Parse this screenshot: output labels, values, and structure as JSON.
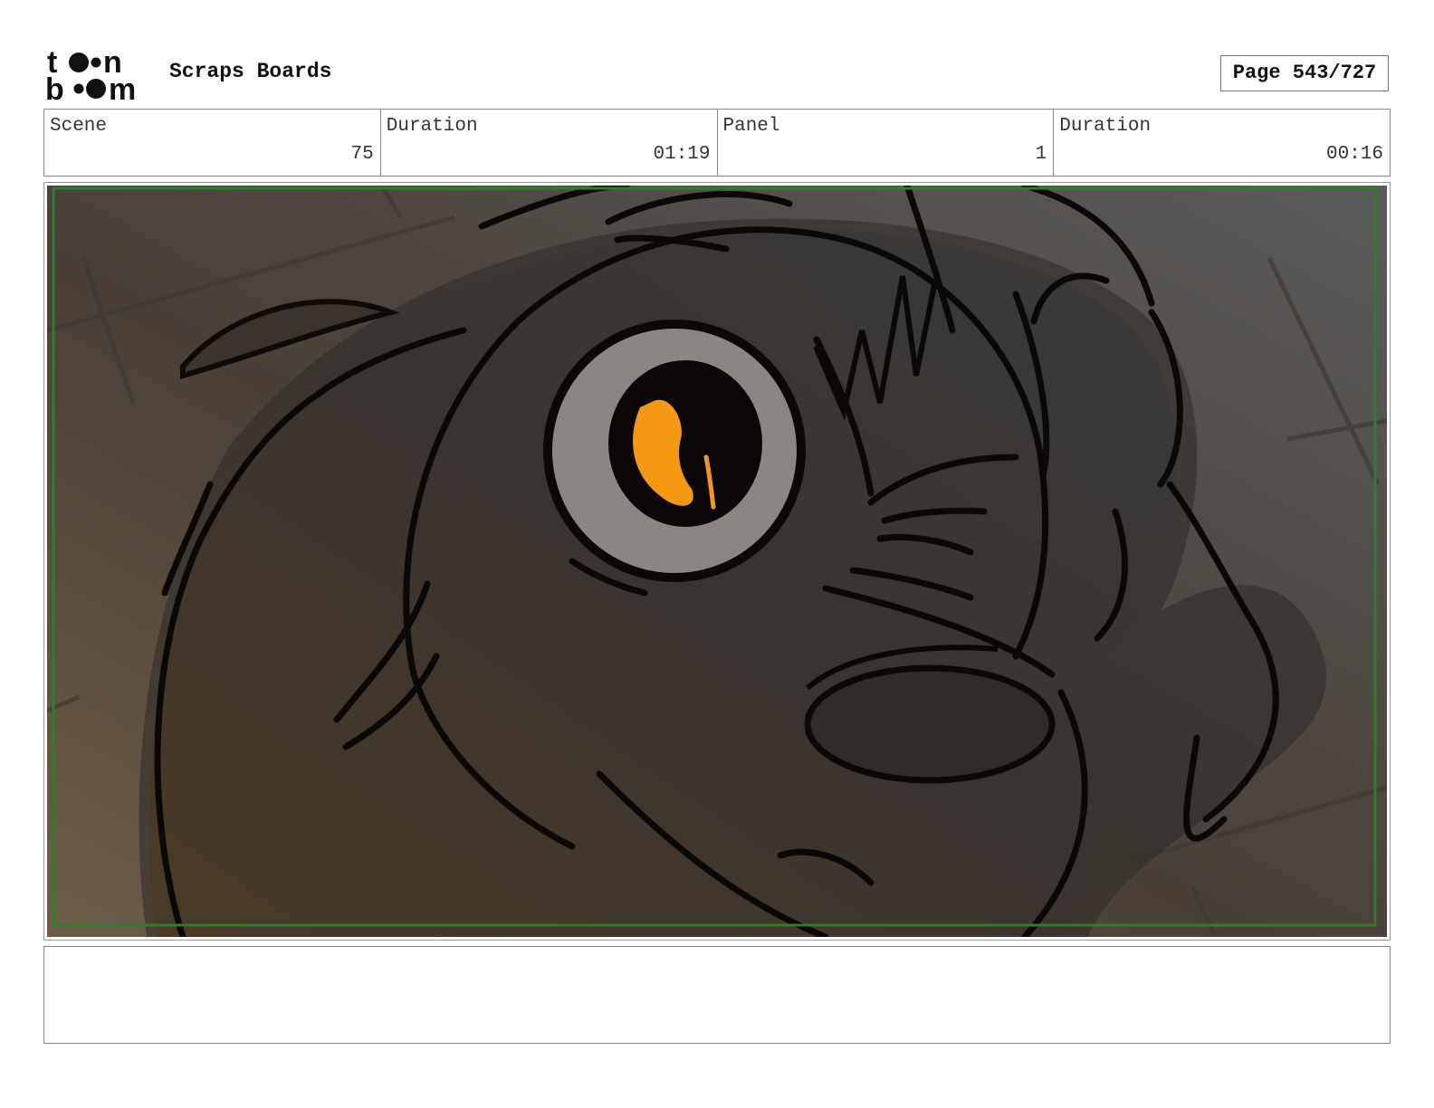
{
  "header": {
    "logo_text": "toon boom",
    "title": "Scraps Boards",
    "page_label": "Page 543/727"
  },
  "info": {
    "scene_label": "Scene",
    "scene_value": "75",
    "scene_duration_label": "Duration",
    "scene_duration_value": "01:19",
    "panel_label": "Panel",
    "panel_value": "1",
    "panel_duration_label": "Duration",
    "panel_duration_value": "00:16"
  },
  "panel": {
    "colors": {
      "eye_iris": "#f39a12",
      "eye_white": "#8a8684",
      "safe_frame": "#2e7d2e",
      "background_warm": "#6b5a46",
      "background_cool": "#5a5a5a"
    }
  },
  "notes": {
    "text": ""
  }
}
